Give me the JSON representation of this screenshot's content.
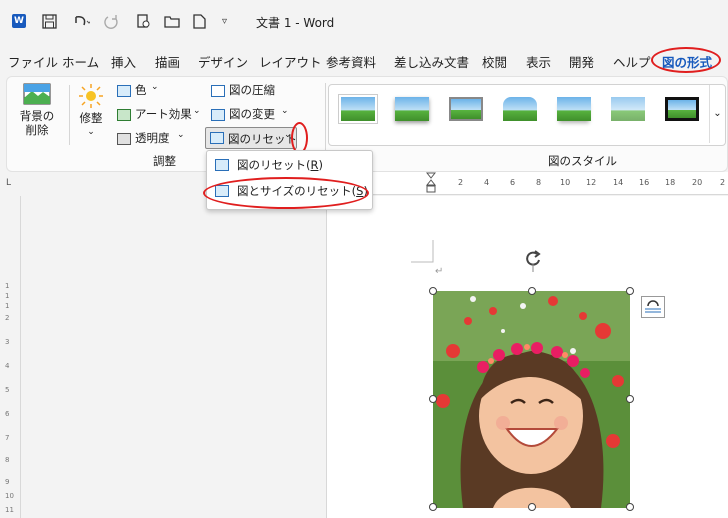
{
  "titlebar": {
    "app_icon": "W",
    "doc_title": "文書 1  -  Word"
  },
  "tabs": [
    "ファイル",
    "ホーム",
    "挿入",
    "描画",
    "デザイン",
    "レイアウト",
    "参考資料",
    "差し込み文書",
    "校閲",
    "表示",
    "開発",
    "ヘルプ",
    "図の形式"
  ],
  "active_tab": "図の形式",
  "ribbon": {
    "remove_bg_label_1": "背景の",
    "remove_bg_label_2": "削除",
    "correct_label": "修整",
    "color_label": "色",
    "art_effect_label": "アート効果",
    "transparency_label": "透明度",
    "compress_label": "図の圧縮",
    "change_label": "図の変更",
    "reset_label": "図のリセット",
    "group_adjust": "調整",
    "group_styles": "図のスタイル"
  },
  "dropdown": {
    "item1": "図のリセット(",
    "item1_key": "R",
    "item1_end": ")",
    "item2": "図とサイズのリセット(",
    "item2_key": "S",
    "item2_end": ")"
  },
  "ruler": {
    "top_numbers": [
      "2",
      "4",
      "6",
      "8",
      "10",
      "12",
      "14",
      "16",
      "18",
      "20",
      "2"
    ],
    "left_numbers": [
      "1",
      "1",
      "1",
      "2",
      "3",
      "4",
      "5",
      "6",
      "7",
      "8",
      "9",
      "10",
      "11"
    ]
  },
  "colors": {
    "accent": "#185abd",
    "annotation": "#e01e1e"
  }
}
